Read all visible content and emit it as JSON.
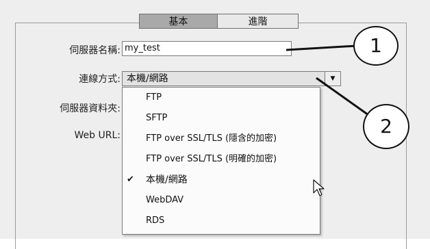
{
  "tabs": {
    "basic": "基本",
    "advanced": "進階"
  },
  "labels": {
    "server_name": "伺服器名稱:",
    "connection_method": "連線方式:",
    "server_folder": "伺服器資料夾:",
    "web_url": "Web URL:"
  },
  "server_name_value": "my_test",
  "connection_method_value": "本機/網路",
  "dropdown_options": [
    "FTP",
    "SFTP",
    "FTP over SSL/TLS (隱含的加密)",
    "FTP over SSL/TLS (明確的加密)",
    "本機/網路",
    "WebDAV",
    "RDS"
  ],
  "selected_option_index": 4,
  "check_mark": "✔",
  "callouts": {
    "one": "1",
    "two": "2"
  }
}
